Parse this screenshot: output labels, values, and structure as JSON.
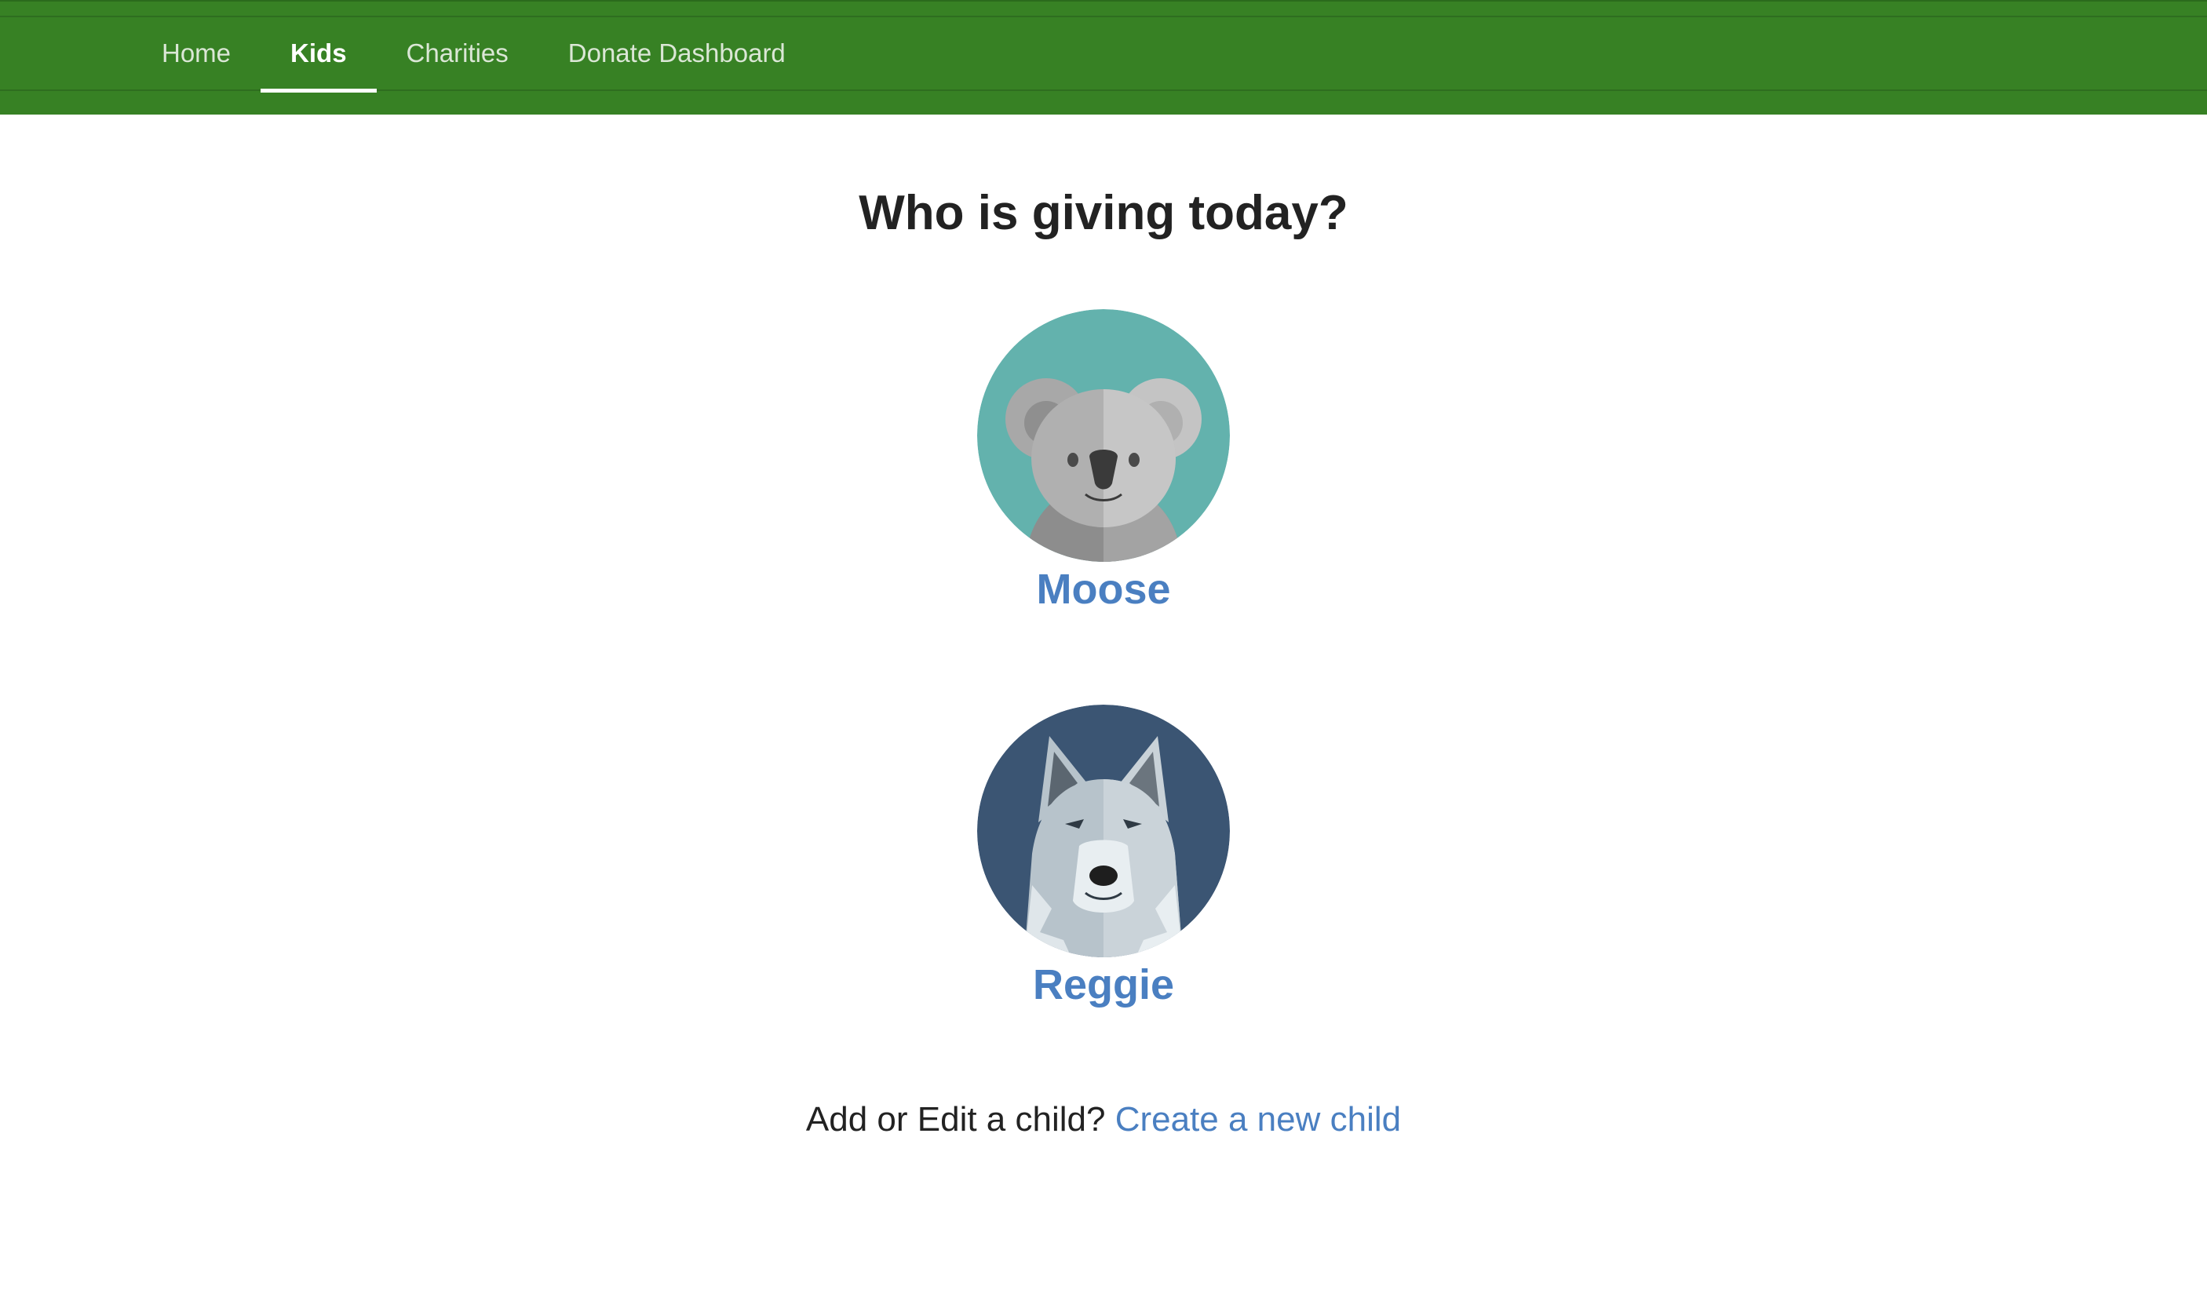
{
  "nav": {
    "items": [
      {
        "label": "Home"
      },
      {
        "label": "Kids"
      },
      {
        "label": "Charities"
      },
      {
        "label": "Donate Dashboard"
      }
    ],
    "active": "Kids",
    "bar_color": "#378124"
  },
  "main": {
    "title": "Who is giving today?",
    "kids": [
      {
        "name": "Moose",
        "avatar_icon": "koala-icon",
        "avatar_bg": "#63b2ad"
      },
      {
        "name": "Reggie",
        "avatar_icon": "wolf-icon",
        "avatar_bg": "#3b5573"
      }
    ],
    "footer": {
      "prompt": "Add or Edit a child?",
      "link": "Create a new child"
    },
    "link_color": "#4a7fc1"
  }
}
